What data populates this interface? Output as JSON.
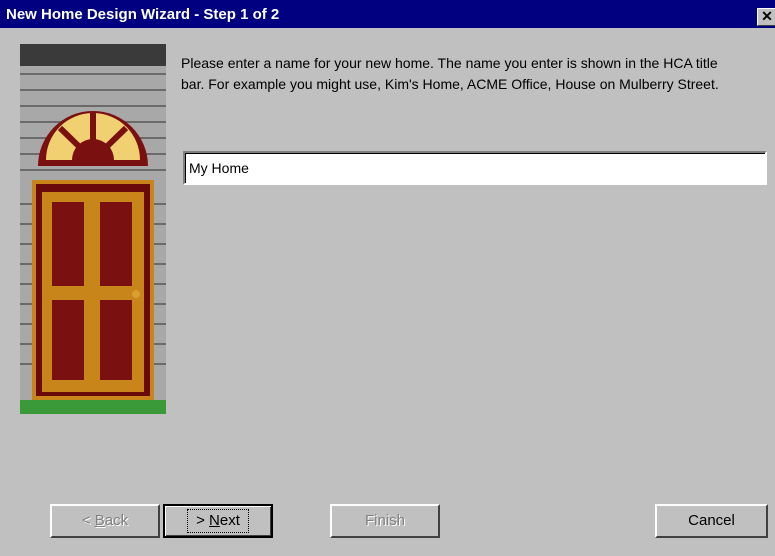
{
  "window": {
    "title": "New Home Design Wizard - Step 1 of 2",
    "close_glyph": "✕"
  },
  "description": "Please enter a name for your new home.  The name you enter is shown in the HCA title bar.  For example you might use, Kim's Home, ACME Office, House on Mulberry Street.",
  "name_field": {
    "value": "My Home"
  },
  "buttons": {
    "back": {
      "prefix": "< ",
      "mnemonic": "B",
      "rest": "ack",
      "enabled": false
    },
    "next": {
      "prefix": "> ",
      "mnemonic": "N",
      "rest": "ext",
      "enabled": true
    },
    "finish": {
      "label": "Finish",
      "enabled": false
    },
    "cancel": {
      "label": "Cancel",
      "enabled": true
    }
  },
  "colors": {
    "titlebar": "#000080",
    "dialog": "#c0c0c0",
    "door": "#7a1010",
    "door_frame": "#c8861a",
    "siding": "#a8a8a8",
    "grass": "#3a9a3a"
  },
  "icons": {
    "illustration": "house-front-door-illustration",
    "close": "close-icon"
  }
}
